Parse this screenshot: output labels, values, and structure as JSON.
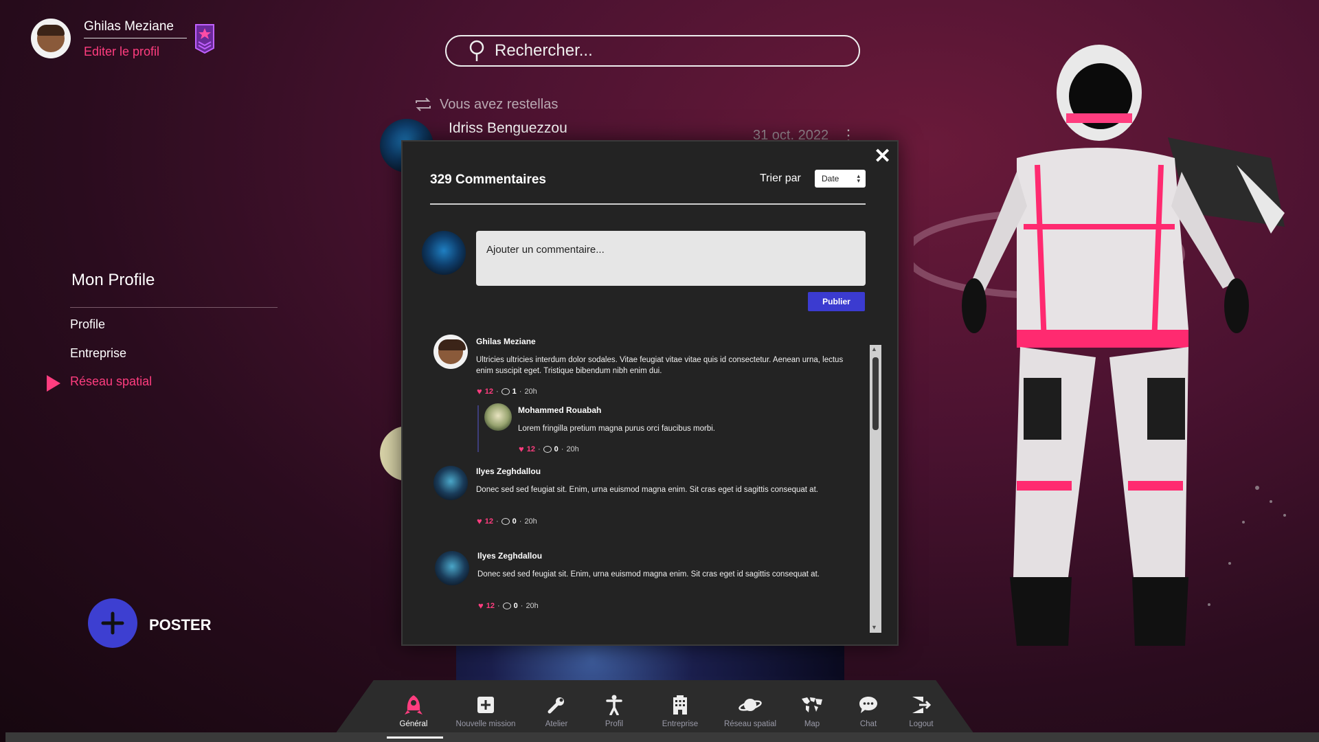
{
  "profile": {
    "name": "Ghilas Meziane",
    "edit_link": "Editer le profil"
  },
  "search": {
    "placeholder": "Rechercher..."
  },
  "feed": {
    "restella_text": "Vous avez restellas",
    "post_author": "Idriss Benguezzou",
    "post_date": "31 oct. 2022"
  },
  "sidebar": {
    "title": "Mon Profile",
    "items": [
      {
        "label": "Profile"
      },
      {
        "label": "Entreprise"
      },
      {
        "label": "Réseau spatial"
      }
    ]
  },
  "poster": {
    "label": "POSTER"
  },
  "modal": {
    "title": "329 Commentaires",
    "sort_label": "Trier par",
    "sort_value": "Date",
    "comment_placeholder": "Ajouter un commentaire...",
    "publish_label": "Publier",
    "comments": [
      {
        "author": "Ghilas Meziane",
        "text": "Ultricies ultricies interdum dolor sodales. Vitae feugiat vitae vitae quis id consectetur. Aenean urna, lectus enim suscipit eget. Tristique bibendum nibh enim dui.",
        "likes": "12",
        "replies": "1",
        "time": "20h"
      },
      {
        "author": "Mohammed Rouabah",
        "text": "Lorem fringilla pretium magna purus orci faucibus morbi.",
        "likes": "12",
        "replies": "0",
        "time": "20h"
      },
      {
        "author": "Ilyes Zeghdallou",
        "text": "Donec sed sed feugiat sit. Enim, urna euismod magna enim. Sit cras eget id sagittis consequat at.",
        "likes": "12",
        "replies": "0",
        "time": "20h"
      },
      {
        "author": "Ilyes Zeghdallou",
        "text": "Donec sed sed feugiat sit. Enim, urna euismod magna enim. Sit cras eget id sagittis consequat at.",
        "likes": "12",
        "replies": "0",
        "time": "20h"
      }
    ]
  },
  "nav": {
    "items": [
      {
        "label": "Général",
        "icon": "rocket-icon"
      },
      {
        "label": "Nouvelle mission",
        "icon": "plus-square-icon"
      },
      {
        "label": "Atelier",
        "icon": "wrench-icon"
      },
      {
        "label": "Profil",
        "icon": "person-icon"
      },
      {
        "label": "Entreprise",
        "icon": "building-icon"
      },
      {
        "label": "Réseau spatial",
        "icon": "planet-icon"
      },
      {
        "label": "Map",
        "icon": "world-map-icon"
      },
      {
        "label": "Chat",
        "icon": "chat-bubble-icon"
      },
      {
        "label": "Logout",
        "icon": "logout-icon"
      }
    ],
    "active_index": 0
  },
  "colors": {
    "accent_pink": "#ff3d7f",
    "accent_blue": "#3b3bd0",
    "modal_bg": "#232323"
  }
}
